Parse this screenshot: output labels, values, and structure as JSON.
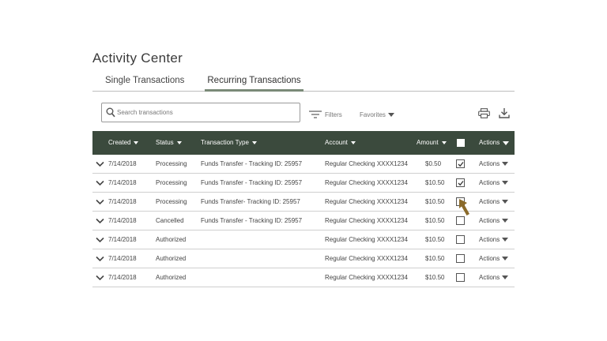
{
  "page": {
    "title": "Activity Center"
  },
  "tabs": [
    {
      "label": "Single Transactions",
      "active": false
    },
    {
      "label": "Recurring Transactions",
      "active": true
    }
  ],
  "search": {
    "placeholder": "Search transactions",
    "value": ""
  },
  "toolbar": {
    "filters_label": "Filters",
    "favorites_label": "Favorites",
    "print_icon": "print-icon",
    "download_icon": "download-icon"
  },
  "table": {
    "columns": {
      "created": "Created",
      "status": "Status",
      "type": "Transaction Type",
      "account": "Account",
      "amount": "Amount",
      "actions": "Actions"
    },
    "rows": [
      {
        "created": "7/14/2018",
        "status": "Processing",
        "type": "Funds Transfer - Tracking ID: 25957",
        "account": "Regular Checking XXXX1234",
        "amount": "$0.50",
        "checked": true,
        "actions": "Actions"
      },
      {
        "created": "7/14/2018",
        "status": "Processing",
        "type": "Funds Transfer - Tracking ID: 25957",
        "account": "Regular Checking XXXX1234",
        "amount": "$10.50",
        "checked": true,
        "actions": "Actions"
      },
      {
        "created": "7/14/2018",
        "status": "Processing",
        "type": "Funds Transfer- Tracking ID: 25957",
        "account": "Regular Checking XXXX1234",
        "amount": "$10.50",
        "checked": false,
        "actions": "Actions"
      },
      {
        "created": "7/14/2018",
        "status": "Cancelled",
        "type": "Funds Transfer - Tracking ID: 25957",
        "account": "Regular Checking XXXX1234",
        "amount": "$10.50",
        "checked": false,
        "actions": "Actions"
      },
      {
        "created": "7/14/2018",
        "status": "Authorized",
        "type": "",
        "account": "Regular Checking XXXX1234",
        "amount": "$10.50",
        "checked": false,
        "actions": "Actions"
      },
      {
        "created": "7/14/2018",
        "status": "Authorized",
        "type": "",
        "account": "Regular Checking XXXX1234",
        "amount": "$10.50",
        "checked": false,
        "actions": "Actions"
      },
      {
        "created": "7/14/2018",
        "status": "Authorized",
        "type": "",
        "account": "Regular Checking XXXX1234",
        "amount": "$10.50",
        "checked": false,
        "actions": "Actions"
      }
    ]
  },
  "colors": {
    "header_bg": "#3b4a3d",
    "active_tab_underline": "#7a8a78",
    "cursor": "#8a6a2a"
  }
}
